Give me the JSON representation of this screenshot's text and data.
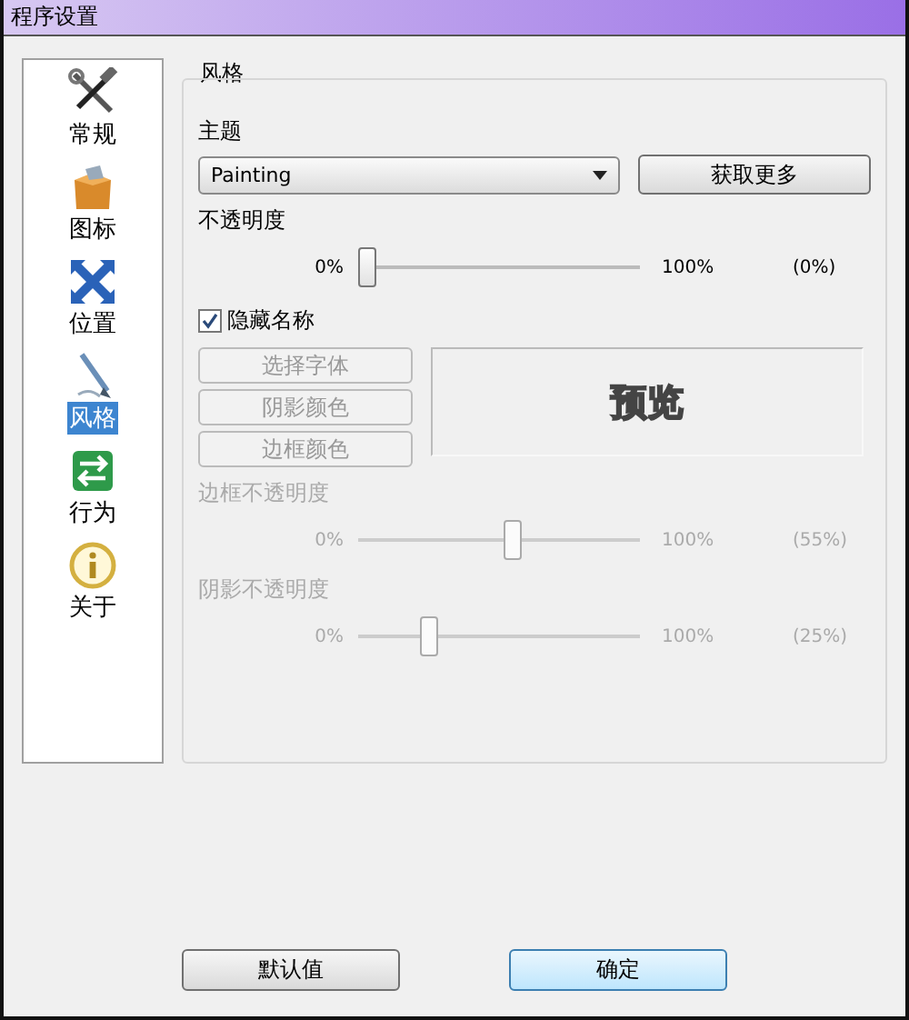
{
  "window": {
    "title": "程序设置"
  },
  "sidebar": {
    "items": [
      {
        "label": "常规",
        "selected": false
      },
      {
        "label": "图标",
        "selected": false
      },
      {
        "label": "位置",
        "selected": false
      },
      {
        "label": "风格",
        "selected": true
      },
      {
        "label": "行为",
        "selected": false
      },
      {
        "label": "关于",
        "selected": false
      }
    ]
  },
  "group": {
    "title": "风格"
  },
  "theme": {
    "label": "主题",
    "value": "Painting",
    "button": "获取更多"
  },
  "opacity_label": "不透明度",
  "sliders": [
    {
      "min": "0%",
      "max": "100%",
      "reading": "(0%)",
      "level": 0,
      "disabled": false
    }
  ],
  "hide_name": {
    "label": "隐藏名称",
    "checked": true
  },
  "style_buttons": [
    {
      "label": "选择字体",
      "disabled": true
    },
    {
      "label": "阴影颜色",
      "disabled": true
    },
    {
      "label": "边框颜色",
      "disabled": true
    }
  ],
  "preview": {
    "text": "预览"
  },
  "sub_sliders": [
    {
      "label": "边框不透明度",
      "min": "0%",
      "max": "100%",
      "reading": "(55%)",
      "level": 0.55,
      "disabled": true
    },
    {
      "label": "阴影不透明度",
      "min": "0%",
      "max": "100%",
      "reading": "(25%)",
      "level": 0.25,
      "disabled": true
    }
  ],
  "buttons": [
    {
      "label": "默认值",
      "kind": "normal"
    },
    {
      "label": "确定",
      "kind": "default"
    }
  ]
}
